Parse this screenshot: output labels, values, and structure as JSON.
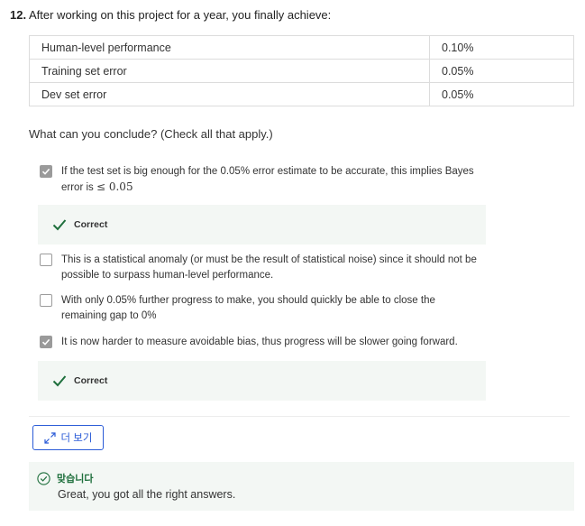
{
  "question": {
    "number": "12.",
    "text": "After working on this project for a year, you finally achieve:"
  },
  "metrics": [
    {
      "label": "Human-level performance",
      "value": "0.10%"
    },
    {
      "label": "Training set error",
      "value": "0.05%"
    },
    {
      "label": "Dev set error",
      "value": "0.05%"
    }
  ],
  "prompt": "What can you conclude? (Check all that apply.)",
  "options": [
    {
      "text": "If the test set is big enough for the 0.05% error estimate to be accurate, this implies Bayes error is",
      "math": "≤ 0.05",
      "checked": true
    },
    {
      "text": "This is a statistical anomaly (or must be the result of statistical noise) since it should not be possible to surpass human-level performance.",
      "checked": false
    },
    {
      "text": "With only 0.05% further progress to make, you should quickly be able to close the remaining gap to 0%",
      "checked": false
    },
    {
      "text": "It is now harder to measure avoidable bias, thus progress will be slower going forward.",
      "checked": true
    }
  ],
  "feedback": {
    "correct_label": "Correct"
  },
  "more_button": {
    "label": "더 보기",
    "icon": "expand-icon"
  },
  "result": {
    "title": "맞습니다",
    "message": "Great, you got all the right answers."
  },
  "colors": {
    "accent": "#2a5bd7",
    "success": "#1e6f3c",
    "feedback_bg": "#f3f7f4",
    "checkbox_checked": "#9a9a9a"
  }
}
